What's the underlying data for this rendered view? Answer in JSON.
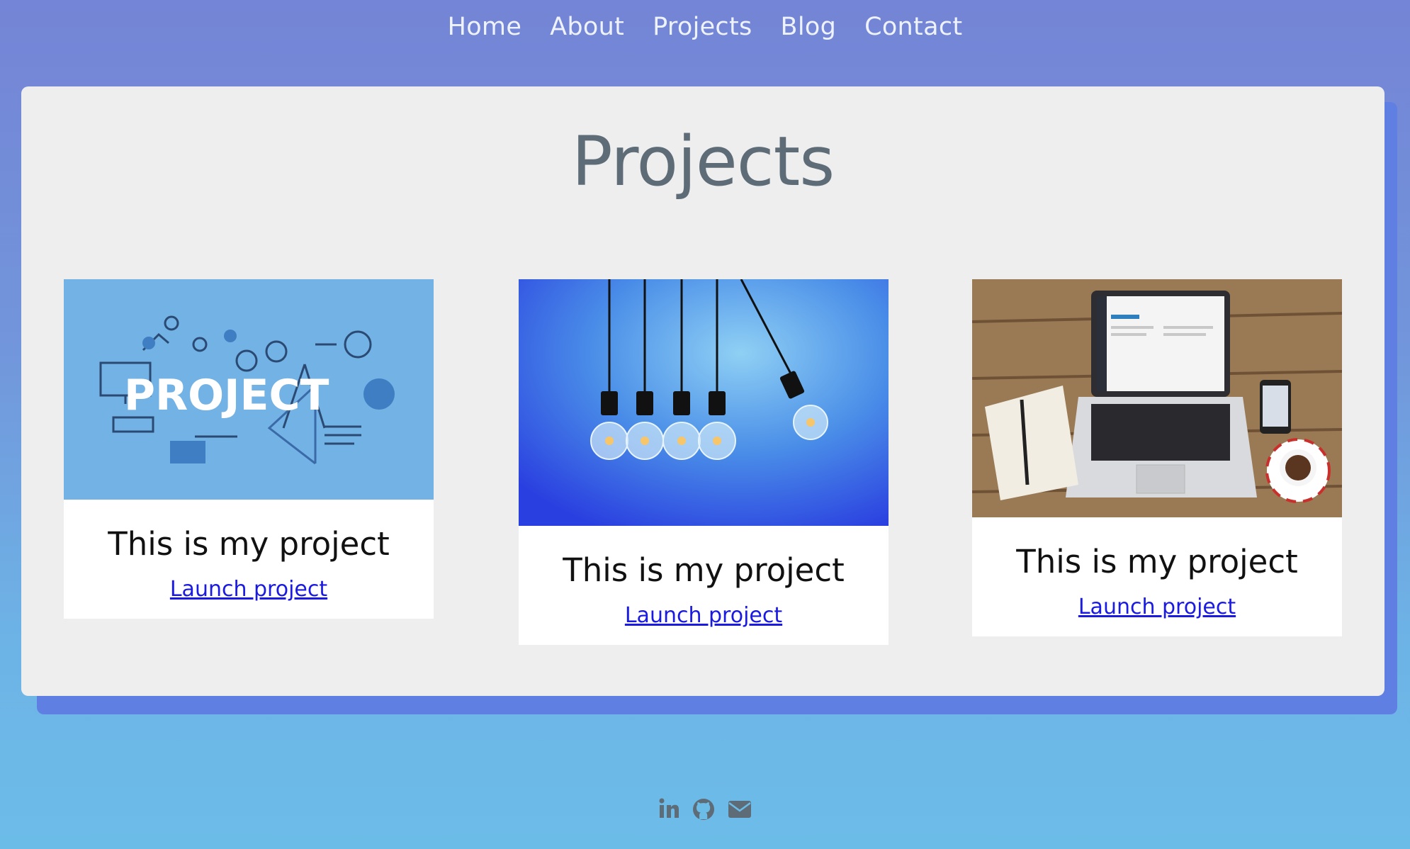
{
  "nav": {
    "items": [
      "Home",
      "About",
      "Projects",
      "Blog",
      "Contact"
    ]
  },
  "page": {
    "title": "Projects"
  },
  "projects": [
    {
      "title": "This is my project",
      "link": "Launch project",
      "image": "project-banner",
      "image_text": "PROJECT"
    },
    {
      "title": "This is my project",
      "link": "Launch project",
      "image": "lightbulbs-photo"
    },
    {
      "title": "This is my project",
      "link": "Launch project",
      "image": "laptop-desk-photo"
    }
  ],
  "footer": {
    "icons": [
      "linkedin-icon",
      "github-icon",
      "email-icon"
    ],
    "color": "#5e6c77"
  },
  "colors": {
    "panel": "#eeeeee",
    "title": "#5e6c77",
    "link": "#1a1ae0",
    "nav_text": "#eef2fb"
  }
}
